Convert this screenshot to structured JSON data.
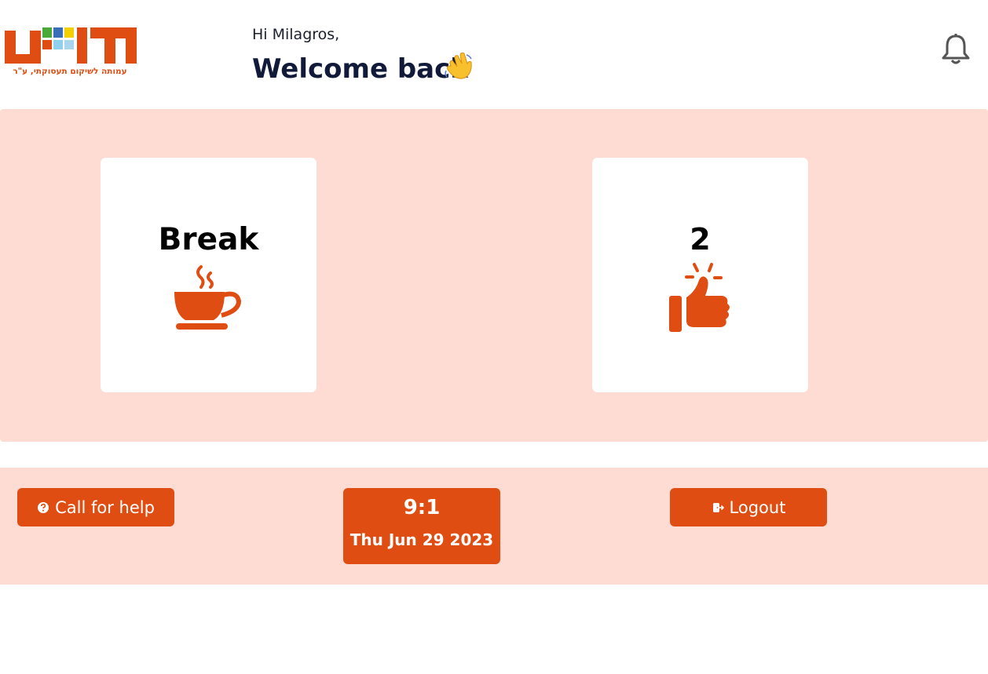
{
  "header": {
    "logo_text": "שוים",
    "logo_tagline": "עמותה לשיקום תעסוקתי, ע\"ר",
    "greeting": "Hi Milagros,",
    "welcome": "Welcome back"
  },
  "cards": {
    "break": {
      "label": "Break",
      "icon": "coffee-cup-icon"
    },
    "likes": {
      "count": "2",
      "icon": "thumbs-up-icon"
    }
  },
  "footer": {
    "help_label": "Call for help",
    "time": "9:1",
    "date": "Thu Jun 29 2023",
    "logout_label": "Logout"
  },
  "colors": {
    "accent": "#e04d12",
    "panel_bg": "#fedcd3",
    "card_bg": "#ffffff",
    "heading": "#121a3a"
  }
}
